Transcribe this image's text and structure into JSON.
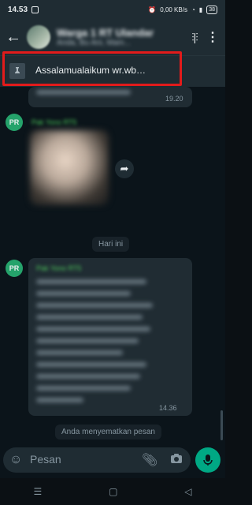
{
  "status_bar": {
    "time": "14.53",
    "data_speed": "0,00 KB/s",
    "battery": "38"
  },
  "header": {
    "back_icon": "arrow-left-icon",
    "title": "Warga 1 RT Ulandar",
    "subtitle": "Anda, Bu Ani, Mam...",
    "voice_icon": "voice-call-icon",
    "more_icon": "more-vert-icon"
  },
  "pinned": {
    "icon": "pin-icon",
    "text": "Assalamualaikum wr.wb…"
  },
  "messages": [
    {
      "type": "text",
      "time": "19.20"
    },
    {
      "type": "sticker",
      "avatar_initials": "PR",
      "sender": "Pak Yono RT5"
    },
    {
      "type": "text",
      "avatar_initials": "PR",
      "sender": "Pak Yono RT5",
      "time": "14.36"
    }
  ],
  "date_divider": "Hari ini",
  "system_message": "Anda menyematkan pesan",
  "composer": {
    "placeholder": "Pesan",
    "emoji_icon": "emoji-icon",
    "attach_icon": "paperclip-icon",
    "camera_icon": "camera-icon",
    "mic_icon": "mic-icon"
  },
  "colors": {
    "accent": "#00a884",
    "highlight": "#e21b1b",
    "bubble": "#202c33"
  }
}
